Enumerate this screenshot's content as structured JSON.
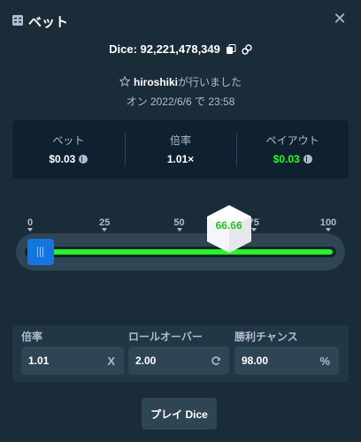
{
  "header": {
    "title": "ベット",
    "icon": "bet-slip-icon",
    "close_icon": "close-icon",
    "close_glyph": "✕"
  },
  "game": {
    "id_text": "Dice: 92,221,478,349",
    "copy_icon": "copy-icon",
    "link_icon": "link-icon"
  },
  "placed": {
    "star_icon": "star-icon",
    "user": "hiroshiki",
    "suffix": "が行いました"
  },
  "date_line": "オン 2022/6/6 で 23:58",
  "stats": {
    "bet_label": "ベット",
    "bet_value": "$0.03",
    "multiplier_label": "倍率",
    "multiplier_value": "1.01×",
    "payout_label": "ペイアウト",
    "payout_value": "$0.03",
    "currency_icon": "litecoin-icon"
  },
  "slider": {
    "ticks": [
      "0",
      "25",
      "50",
      "75",
      "100"
    ],
    "tick_values": [
      0,
      25,
      50,
      75,
      100
    ],
    "roll_over": 2.0,
    "result": "66.66",
    "result_value": 66.66,
    "colors": {
      "lose": "#ff4d4d",
      "win": "#1fff20",
      "handle": "#1475e1"
    }
  },
  "controls": {
    "multiplier_label": "倍率",
    "multiplier_value": "1.01",
    "multiplier_suffix": "X",
    "rollover_label": "ロールオーバー",
    "rollover_value": "2.00",
    "rollover_icon": "refresh-icon",
    "chance_label": "勝利チャンス",
    "chance_value": "98.00",
    "chance_suffix": "%"
  },
  "play_button": "プレイ Dice"
}
